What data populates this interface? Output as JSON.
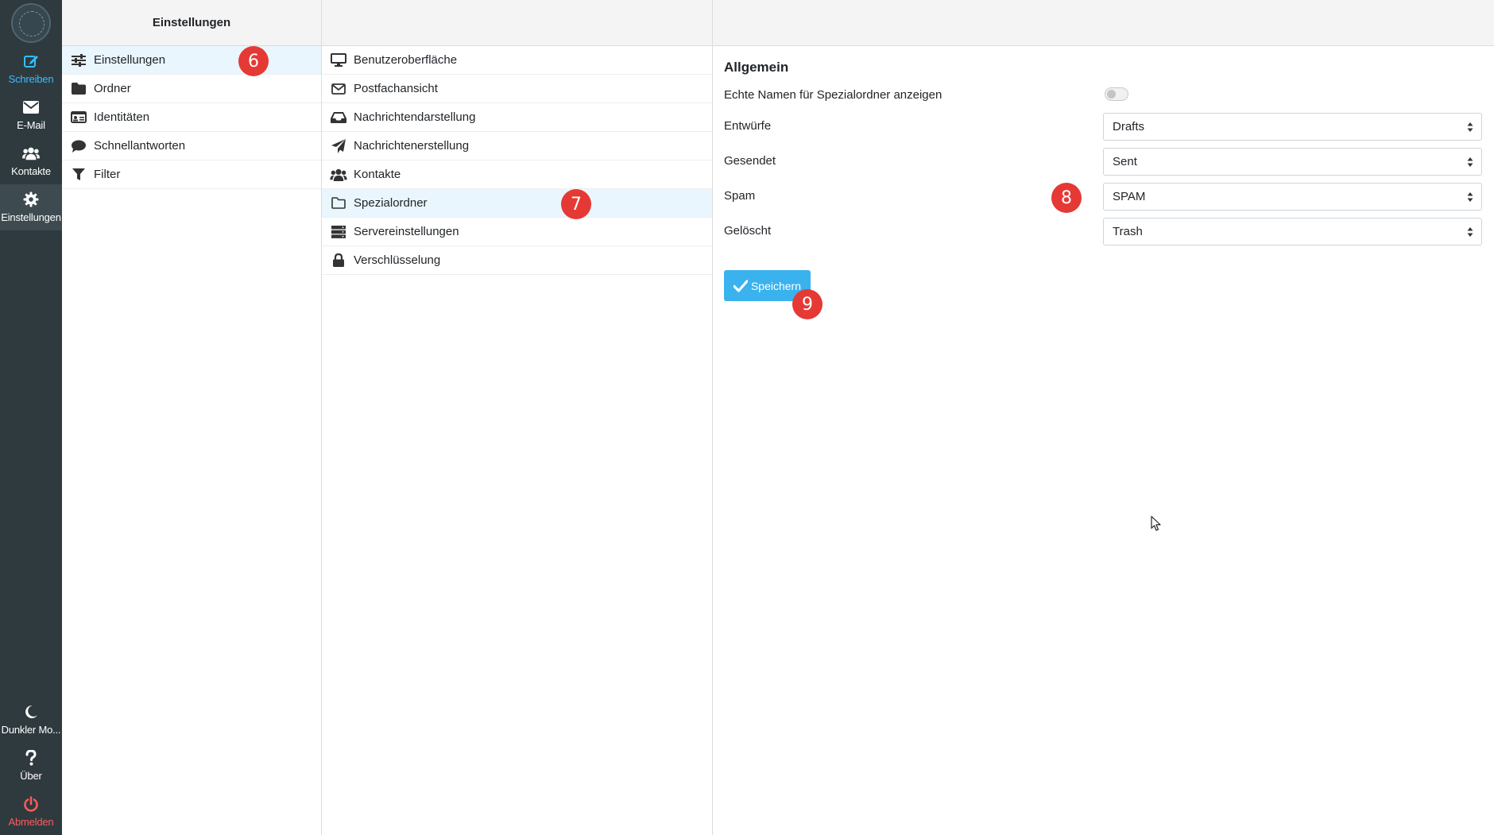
{
  "nav": {
    "compose": "Schreiben",
    "mail": "E-Mail",
    "contacts": "Kontakte",
    "settings": "Einstellungen",
    "darkmode": "Dunkler Mo...",
    "about": "Über",
    "logout": "Abmelden"
  },
  "colors": {
    "accent": "#39b2ee",
    "nav_bg": "#2f3a3f",
    "badge": "#e53935",
    "logout": "#ff5b5b"
  },
  "col1": {
    "header": "Einstellungen",
    "items": [
      {
        "label": "Einstellungen",
        "icon": "sliders-icon"
      },
      {
        "label": "Ordner",
        "icon": "folder-icon"
      },
      {
        "label": "Identitäten",
        "icon": "id-card-icon"
      },
      {
        "label": "Schnellantworten",
        "icon": "comment-icon"
      },
      {
        "label": "Filter",
        "icon": "filter-icon"
      }
    ]
  },
  "col2": {
    "items": [
      {
        "label": "Benutzeroberfläche",
        "icon": "monitor-icon"
      },
      {
        "label": "Postfachansicht",
        "icon": "envelope-icon"
      },
      {
        "label": "Nachrichtendarstellung",
        "icon": "inbox-icon"
      },
      {
        "label": "Nachrichtenerstellung",
        "icon": "paper-plane-icon"
      },
      {
        "label": "Kontakte",
        "icon": "users-icon"
      },
      {
        "label": "Spezialordner",
        "icon": "folder-open-icon"
      },
      {
        "label": "Servereinstellungen",
        "icon": "server-icon"
      },
      {
        "label": "Verschlüsselung",
        "icon": "lock-icon"
      }
    ]
  },
  "content": {
    "section_title": "Allgemein",
    "show_real_names_label": "Echte Namen für Spezialordner anzeigen",
    "drafts_label": "Entwürfe",
    "drafts_value": "Drafts",
    "sent_label": "Gesendet",
    "sent_value": "Sent",
    "spam_label": "Spam",
    "spam_value": "SPAM",
    "trash_label": "Gelöscht",
    "trash_value": "Trash",
    "save_label": "Speichern"
  },
  "badges": {
    "b6": "6",
    "b7": "7",
    "b8": "8",
    "b9": "9"
  }
}
